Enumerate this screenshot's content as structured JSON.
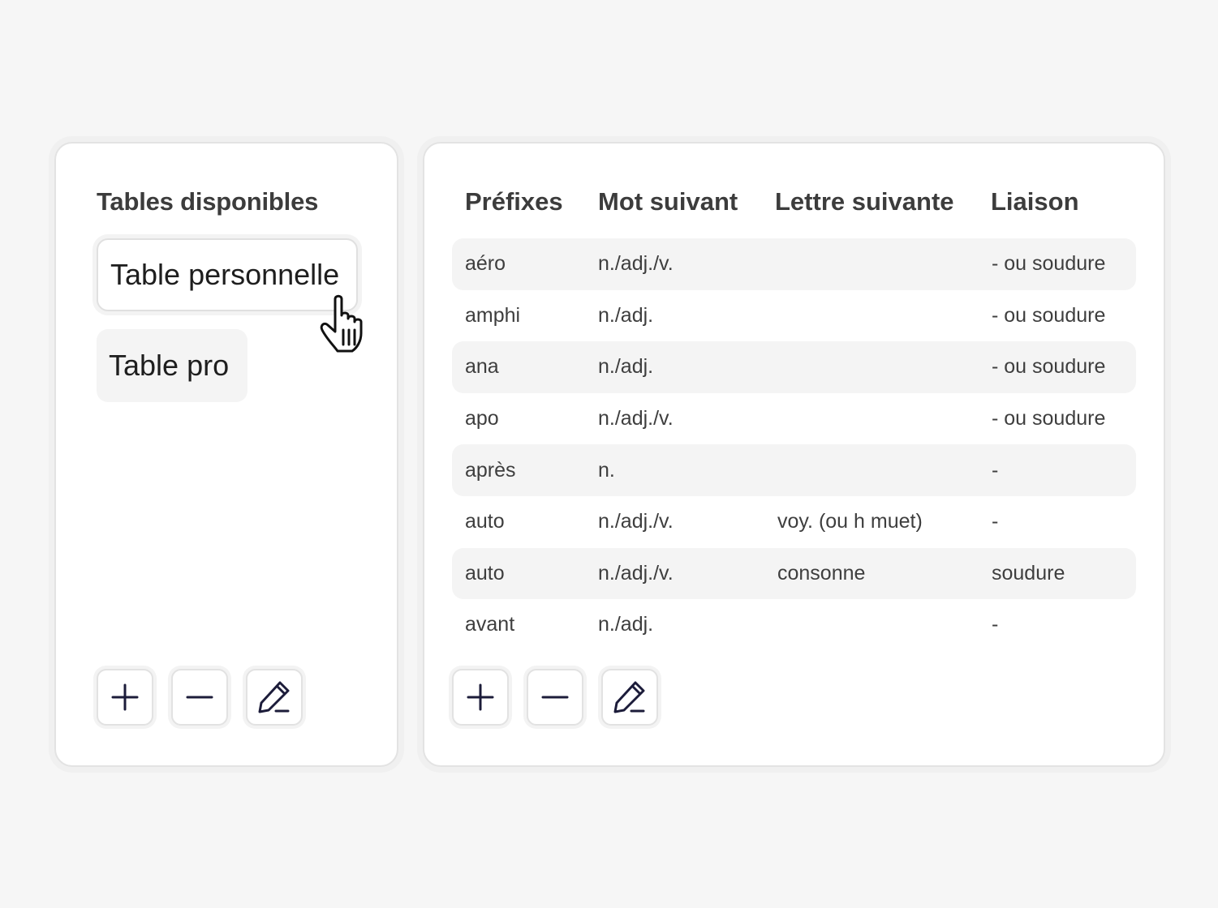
{
  "sidebar": {
    "title": "Tables disponibles",
    "items": [
      {
        "label": "Table personnelle",
        "selected": true
      },
      {
        "label": "Table pro",
        "selected": false
      }
    ],
    "buttons": {
      "add": "plus-icon",
      "remove": "minus-icon",
      "edit": "pencil-icon"
    }
  },
  "table": {
    "headers": [
      "Préfixes",
      "Mot suivant",
      "Lettre suivante",
      "Liaison"
    ],
    "rows": [
      [
        "aéro",
        "n./adj./v.",
        "",
        "- ou soudure"
      ],
      [
        "amphi",
        "n./adj.",
        "",
        "- ou soudure"
      ],
      [
        "ana",
        "n./adj.",
        "",
        "- ou soudure"
      ],
      [
        "apo",
        "n./adj./v.",
        "",
        "- ou soudure"
      ],
      [
        "après",
        "n.",
        "",
        "-"
      ],
      [
        "auto",
        "n./adj./v.",
        "voy. (ou h muet)",
        "-"
      ],
      [
        "auto",
        "n./adj./v.",
        "consonne",
        "soudure"
      ],
      [
        "avant",
        "n./adj.",
        "",
        "-"
      ]
    ],
    "buttons": {
      "add": "plus-icon",
      "remove": "minus-icon",
      "edit": "pencil-icon"
    }
  },
  "colors": {
    "background": "#f6f6f6",
    "panel": "#ffffff",
    "row_shade": "#f4f4f4",
    "icon": "#1c1c3a"
  }
}
